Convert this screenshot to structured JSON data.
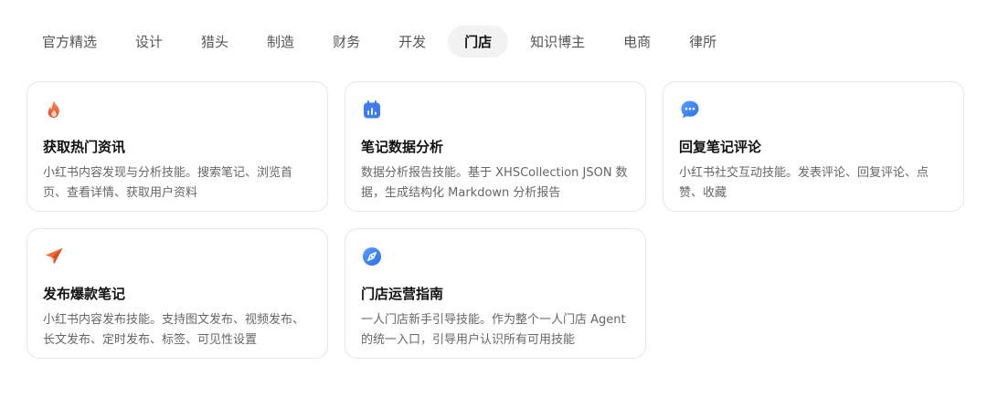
{
  "tabs": [
    {
      "label": "官方精选",
      "active": false
    },
    {
      "label": "设计",
      "active": false
    },
    {
      "label": "猎头",
      "active": false
    },
    {
      "label": "制造",
      "active": false
    },
    {
      "label": "财务",
      "active": false
    },
    {
      "label": "开发",
      "active": false
    },
    {
      "label": "门店",
      "active": true
    },
    {
      "label": "知识博主",
      "active": false
    },
    {
      "label": "电商",
      "active": false
    },
    {
      "label": "律所",
      "active": false
    }
  ],
  "cards": [
    {
      "title": "获取热门资讯",
      "desc": "小红书内容发现与分析技能。搜索笔记、浏览首页、查看详情、获取用户资料",
      "icon": "fire-icon"
    },
    {
      "title": "笔记数据分析",
      "desc": "数据分析报告技能。基于 XHSCollection JSON 数据，生成结构化 Markdown 分析报告",
      "icon": "calendar-chart-icon"
    },
    {
      "title": "回复笔记评论",
      "desc": "小红书社交互动技能。发表评论、回复评论、点赞、收藏",
      "icon": "chat-bubble-icon"
    },
    {
      "title": "发布爆款笔记",
      "desc": "小红书内容发布技能。支持图文发布、视频发布、长文发布、定时发布、标签、可见性设置",
      "icon": "paper-plane-icon"
    },
    {
      "title": "门店运营指南",
      "desc": "一人门店新手引导技能。作为整个一人门店 Agent 的统一入口，引导用户认识所有可用技能",
      "icon": "compass-icon"
    }
  ],
  "colors": {
    "fire": "#f0642f",
    "calendar": "#3d7cf0",
    "chat": "#3b82f6",
    "plane": "#f06a3a",
    "compass": "#3b82f6"
  }
}
